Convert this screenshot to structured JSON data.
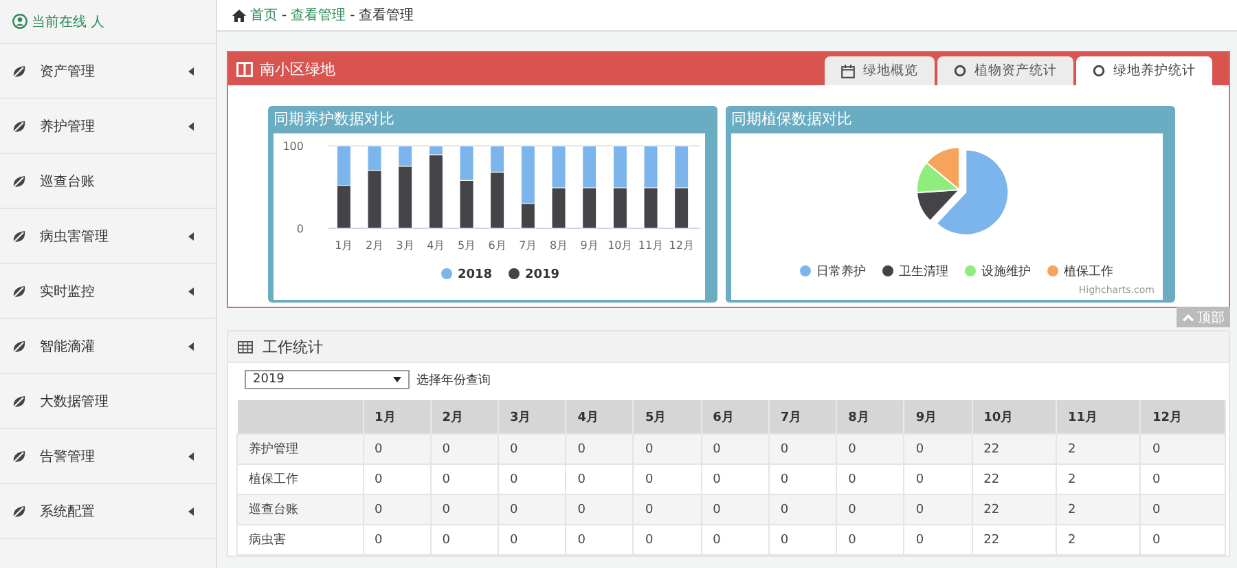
{
  "sidebar": {
    "online_label": "当前在线 人",
    "items": [
      {
        "label": "资产管理",
        "has_submenu": true
      },
      {
        "label": "养护管理",
        "has_submenu": true
      },
      {
        "label": "巡查台账",
        "has_submenu": false
      },
      {
        "label": "病虫害管理",
        "has_submenu": true
      },
      {
        "label": "实时监控",
        "has_submenu": true
      },
      {
        "label": "智能滴灌",
        "has_submenu": true
      },
      {
        "label": "大数据管理",
        "has_submenu": false
      },
      {
        "label": "告警管理",
        "has_submenu": true
      },
      {
        "label": "系统配置",
        "has_submenu": true
      }
    ]
  },
  "breadcrumb": [
    {
      "label": "首页",
      "link": true
    },
    {
      "label": "-",
      "link": false
    },
    {
      "label": "查看管理",
      "link": true
    },
    {
      "label": "-",
      "link": false
    },
    {
      "label": "查看管理",
      "link": false
    }
  ],
  "panel": {
    "title": "南小区绿地",
    "tabs": [
      {
        "label": "绿地概览",
        "selected": false
      },
      {
        "label": "植物资产统计",
        "selected": false
      },
      {
        "label": "绿地养护统计",
        "selected": true
      }
    ]
  },
  "bar_card": {
    "title": "同期养护数据对比",
    "chart_data": {
      "type": "bar",
      "stacked": true,
      "legend": "bottom",
      "categories": [
        "1月",
        "2月",
        "3月",
        "4月",
        "5月",
        "6月",
        "7月",
        "8月",
        "9月",
        "10月",
        "11月",
        "12月"
      ],
      "ylim": [
        0,
        100
      ],
      "yticks": [
        0,
        100
      ],
      "series": [
        {
          "name": "2018",
          "color": "#7cb5ec",
          "values": [
            48,
            30,
            25,
            11,
            42,
            32,
            70,
            51,
            51,
            51,
            51,
            51
          ]
        },
        {
          "name": "2019",
          "color": "#434348",
          "values": [
            52,
            70,
            75,
            89,
            58,
            68,
            30,
            49,
            49,
            49,
            49,
            49
          ]
        }
      ]
    }
  },
  "pie_card": {
    "title": "同期植保数据对比",
    "legend": [
      {
        "label": "日常养护",
        "color": "#7cb5ec"
      },
      {
        "label": "卫生清理",
        "color": "#434348"
      },
      {
        "label": "设施维护",
        "color": "#90ed7d"
      },
      {
        "label": "植保工作",
        "color": "#f7a35c"
      }
    ],
    "credit": "Highcharts.com"
  },
  "top_button": "顶部",
  "stats": {
    "title": "工作统计",
    "year_select": "2019",
    "select_hint": "选择年份查询",
    "columns": [
      "1月",
      "2月",
      "3月",
      "4月",
      "5月",
      "6月",
      "7月",
      "8月",
      "9月",
      "10月",
      "11月",
      "12月"
    ],
    "rows": [
      {
        "label": "养护管理",
        "cells": [
          "0",
          "0",
          "0",
          "0",
          "0",
          "0",
          "0",
          "0",
          "0",
          "22",
          "2",
          "0"
        ]
      },
      {
        "label": "植保工作",
        "cells": [
          "0",
          "0",
          "0",
          "0",
          "0",
          "0",
          "0",
          "0",
          "0",
          "22",
          "2",
          "0"
        ]
      },
      {
        "label": "巡查台账",
        "cells": [
          "0",
          "0",
          "0",
          "0",
          "0",
          "0",
          "0",
          "0",
          "0",
          "22",
          "2",
          "0"
        ]
      },
      {
        "label": "病虫害",
        "cells": [
          "0",
          "0",
          "0",
          "0",
          "0",
          "0",
          "0",
          "0",
          "0",
          "22",
          "2",
          "0"
        ]
      }
    ]
  }
}
